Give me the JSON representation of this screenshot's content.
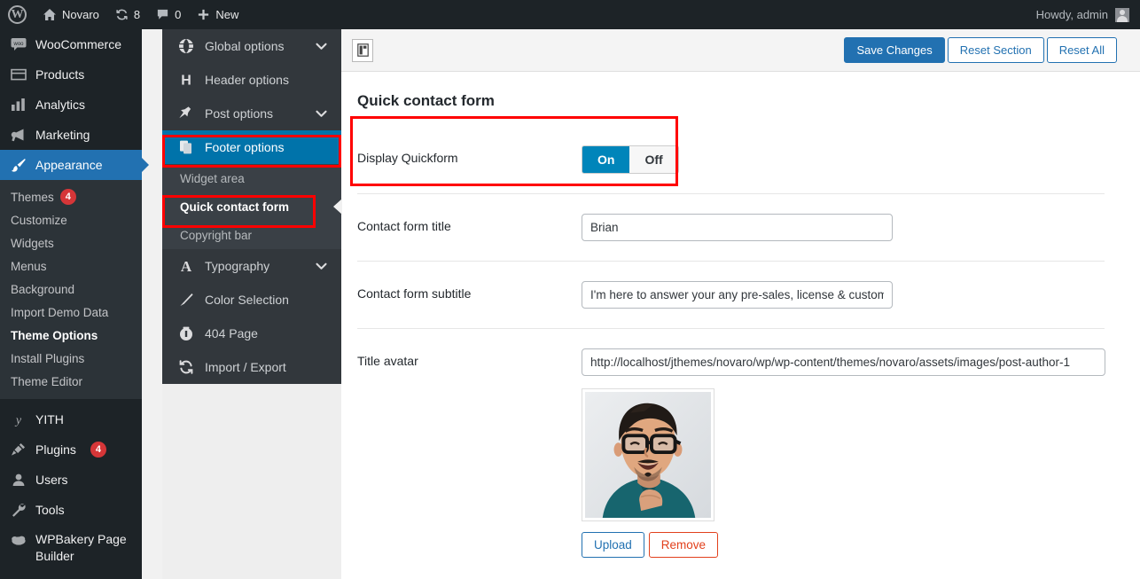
{
  "adminbar": {
    "wp_logo": "wordpress-logo",
    "site_name": "Novaro",
    "updates_count": "8",
    "comments_count": "0",
    "new_label": "New",
    "howdy": "Howdy, admin"
  },
  "wpmenu": {
    "items": [
      {
        "label": "WooCommerce",
        "icon": "woocommerce-icon"
      },
      {
        "label": "Products",
        "icon": "products-icon"
      },
      {
        "label": "Analytics",
        "icon": "analytics-icon"
      },
      {
        "label": "Marketing",
        "icon": "marketing-megaphone-icon"
      },
      {
        "label": "Appearance",
        "icon": "appearance-brush-icon",
        "current": true
      }
    ],
    "appearance_submenu": [
      {
        "label": "Themes",
        "badge": "4"
      },
      {
        "label": "Customize"
      },
      {
        "label": "Widgets"
      },
      {
        "label": "Menus"
      },
      {
        "label": "Background"
      },
      {
        "label": "Import Demo Data"
      },
      {
        "label": "Theme Options",
        "active": true
      },
      {
        "label": "Install Plugins"
      },
      {
        "label": "Theme Editor"
      }
    ],
    "items_bottom": [
      {
        "label": "YITH",
        "icon": "yith-icon"
      },
      {
        "label": "Plugins",
        "icon": "plugins-plug-icon",
        "badge": "4"
      },
      {
        "label": "Users",
        "icon": "users-icon"
      },
      {
        "label": "Tools",
        "icon": "tools-wrench-icon"
      },
      {
        "label": "WPBakery Page Builder",
        "icon": "wpbakery-icon"
      }
    ]
  },
  "options_panel": {
    "items": [
      {
        "label": "Global options",
        "icon": "globe-icon",
        "chevron": "⌄"
      },
      {
        "label": "Header options",
        "icon": "header-h-icon"
      },
      {
        "label": "Post options",
        "icon": "pin-icon",
        "chevron": "⌄"
      },
      {
        "label": "Footer options",
        "icon": "footer-pages-icon",
        "selected": true
      }
    ],
    "footer_subitems": [
      {
        "label": "Widget area"
      },
      {
        "label": "Quick contact form",
        "active": true
      },
      {
        "label": "Copyright bar"
      }
    ],
    "items_after": [
      {
        "label": "Typography",
        "icon": "typography-a-icon",
        "chevron": "⌄"
      },
      {
        "label": "Color Selection",
        "icon": "color-brush-icon"
      },
      {
        "label": "404 Page",
        "icon": "404-icon"
      },
      {
        "label": "Import / Export",
        "icon": "import-export-icon"
      }
    ]
  },
  "toolbar": {
    "layout_icon": "layout-toggle-icon",
    "save_label": "Save Changes",
    "reset_section_label": "Reset Section",
    "reset_all_label": "Reset All"
  },
  "page": {
    "title": "Quick contact form",
    "fields": {
      "display_quickform": {
        "label": "Display Quickform",
        "on_label": "On",
        "off_label": "Off",
        "value": "On"
      },
      "contact_form_title": {
        "label": "Contact form title",
        "value": "Brian"
      },
      "contact_form_subtitle": {
        "label": "Contact form subtitle",
        "value": "I'm here to answer your any pre-sales, license & custom"
      },
      "title_avatar": {
        "label": "Title avatar",
        "value": "http://localhost/jthemes/novaro/wp/wp-content/themes/novaro/assets/images/post-author-1",
        "upload_label": "Upload",
        "remove_label": "Remove",
        "image_alt": "avatar-photo-man-with-glasses"
      }
    }
  },
  "colors": {
    "accent_blue": "#2271b1",
    "toggle_blue": "#0085ba",
    "panel_selected": "#0073aa",
    "highlight_red": "#ff0000",
    "danger": "#e2401c"
  }
}
